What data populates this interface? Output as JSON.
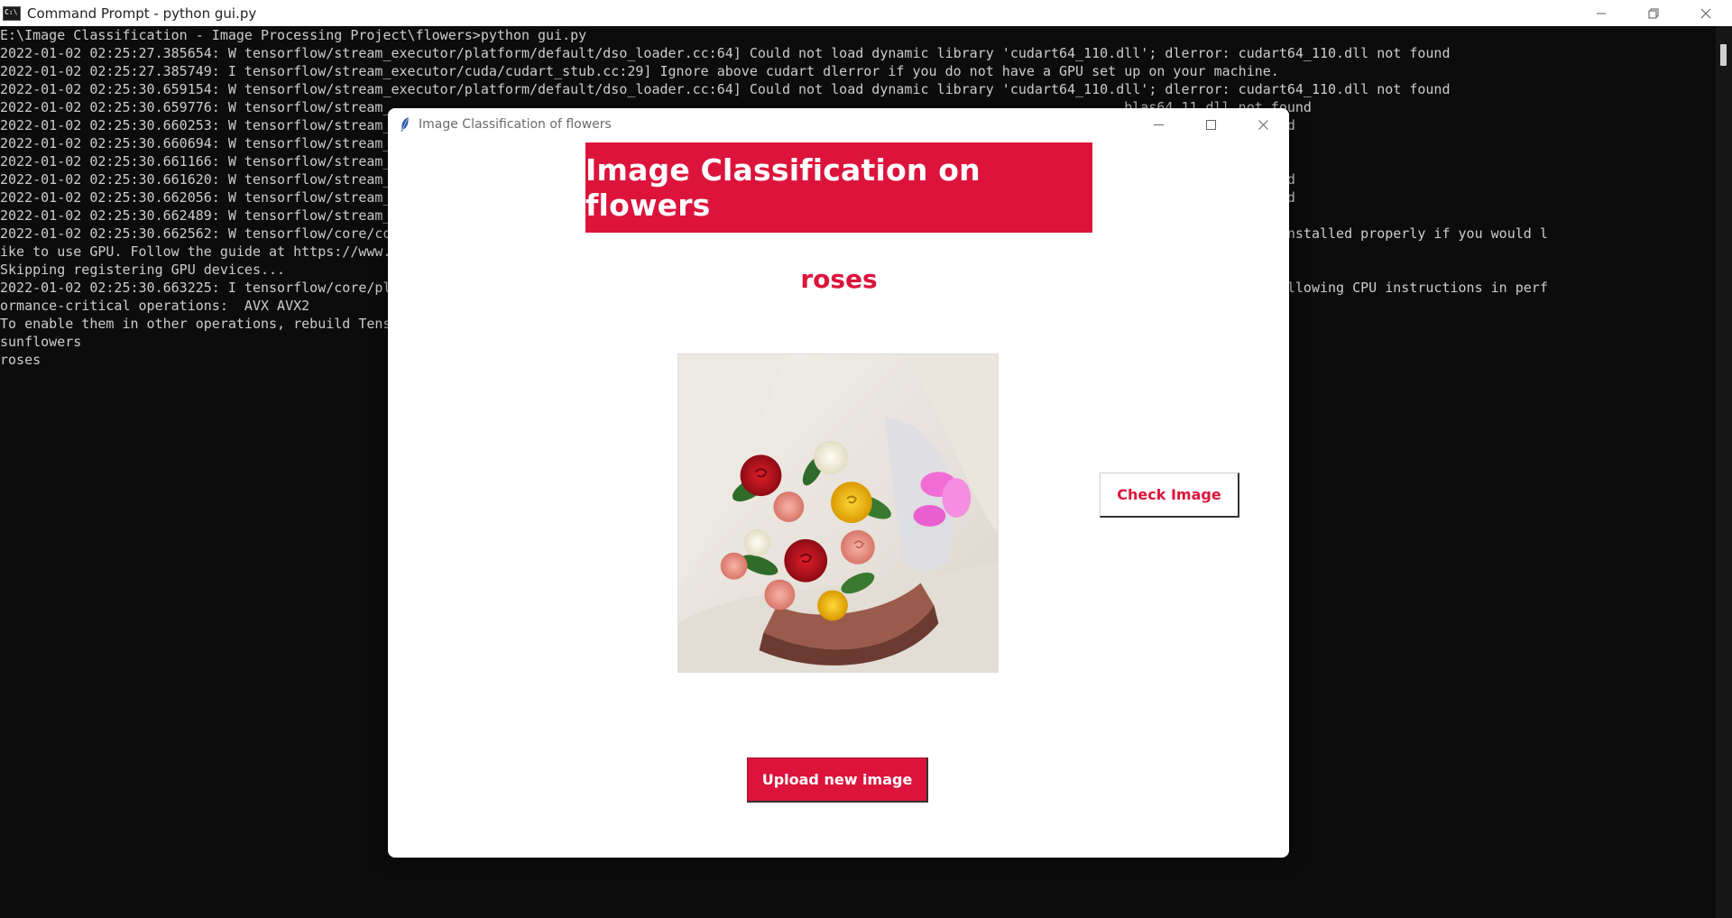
{
  "console_window": {
    "title": "Command Prompt - python  gui.py",
    "icon": "cmd-icon",
    "controls": [
      "minimize-icon",
      "restore-icon",
      "close-icon"
    ],
    "lines": [
      "E:\\Image Classification - Image Processing Project\\flowers>python gui.py",
      "2022-01-02 02:25:27.385654: W tensorflow/stream_executor/platform/default/dso_loader.cc:64] Could not load dynamic library 'cudart64_110.dll'; dlerror: cudart64_110.dll not found",
      "2022-01-02 02:25:27.385749: I tensorflow/stream_executor/cuda/cudart_stub.cc:29] Ignore above cudart dlerror if you do not have a GPU set up on your machine.",
      "2022-01-02 02:25:30.659154: W tensorflow/stream_executor/platform/default/dso_loader.cc:64] Could not load dynamic library 'cudart64_110.dll'; dlerror: cudart64_110.dll not found",
      "2022-01-02 02:25:30.659776: W tensorflow/stream_                                                                                          blas64_11.dll not found",
      "2022-01-02 02:25:30.660253: W tensorflow/stream_                                                                                          Lt64_11.dll not found",
      "2022-01-02 02:25:30.660694: W tensorflow/stream_                                                                                          0.dll not found",
      "2022-01-02 02:25:30.661166: W tensorflow/stream_                                                                                          _10.dll not found",
      "2022-01-02 02:25:30.661620: W tensorflow/stream_                                                                                          er64_11.dll not found",
      "2022-01-02 02:25:30.662056: W tensorflow/stream_                                                                                          se64_11.dll not found",
      "2022-01-02 02:25:30.662489: W tensorflow/stream_                                                                                          dll not found",
      "2022-01-02 02:25:30.662562: W tensorflow/core/co                                                                                          entioned above are installed properly if you would l",
      "ike to use GPU. Follow the guide at https://www.",
      "Skipping registering GPU devices...",
      "2022-01-02 02:25:30.663225: I tensorflow/core/pl                                                                                          neDNN) to use the following CPU instructions in perf",
      "ormance-critical operations:  AVX AVX2",
      "To enable them in other operations, rebuild Tens",
      "sunflowers",
      "roses"
    ]
  },
  "app_window": {
    "title": "Image Classification of flowers",
    "icon": "feather-icon",
    "controls": [
      "minimize-icon",
      "maximize-icon",
      "close-icon"
    ],
    "heading": "Image Classification on flowers",
    "result": "roses",
    "image_alt": "rose-bouquet-photo",
    "check_button": "Check Image",
    "upload_button": "Upload new image"
  },
  "colors": {
    "accent": "#dc143c",
    "console_bg": "#0c0c0c",
    "console_text": "#cccccc",
    "window_bg": "#ffffff"
  }
}
